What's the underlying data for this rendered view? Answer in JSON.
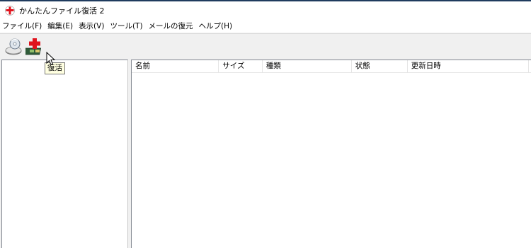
{
  "window": {
    "title": "かんたんファイル復活 2",
    "icon": "app-red-cross-icon"
  },
  "menu": [
    {
      "label": "ファイル(F)"
    },
    {
      "label": "編集(E)"
    },
    {
      "label": "表示(V)"
    },
    {
      "label": "ツール(T)"
    },
    {
      "label": "メールの復元"
    },
    {
      "label": "ヘルプ(H)"
    }
  ],
  "toolbar": {
    "buttons": [
      {
        "icon": "disk-scan-icon"
      },
      {
        "icon": "restore-icon"
      }
    ],
    "tooltip": "復活"
  },
  "file_list": {
    "columns": [
      "名前",
      "サイズ",
      "種類",
      "状態",
      "更新日時",
      ""
    ]
  },
  "colors": {
    "accent_red": "#e0141e",
    "title_bar_border": "#1f3b5e"
  }
}
